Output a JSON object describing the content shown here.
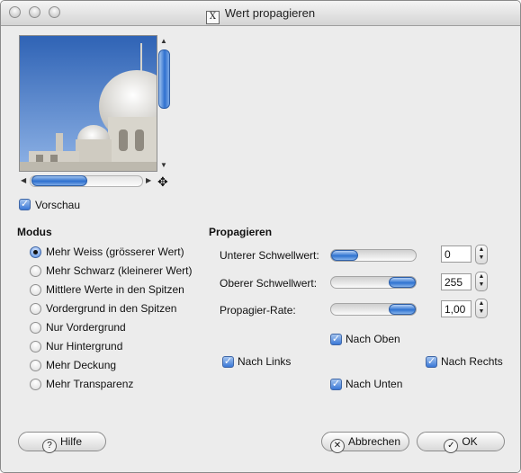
{
  "window": {
    "title": "Wert propagieren",
    "x11_glyph": "X"
  },
  "preview": {
    "checkbox_label": "Vorschau",
    "checked": true
  },
  "modus": {
    "heading": "Modus",
    "options": [
      {
        "label": "Mehr Weiss (grösserer Wert)",
        "selected": true
      },
      {
        "label": "Mehr Schwarz (kleinerer Wert)",
        "selected": false
      },
      {
        "label": "Mittlere Werte in den Spitzen",
        "selected": false
      },
      {
        "label": "Vordergrund in den Spitzen",
        "selected": false
      },
      {
        "label": "Nur Vordergrund",
        "selected": false
      },
      {
        "label": "Nur Hintergrund",
        "selected": false
      },
      {
        "label": "Mehr Deckung",
        "selected": false
      },
      {
        "label": "Mehr Transparenz",
        "selected": false
      }
    ]
  },
  "propagieren": {
    "heading": "Propagieren",
    "sliders": [
      {
        "label": "Unterer Schwellwert:",
        "value": "0",
        "fraction": 0.0
      },
      {
        "label": "Oberer Schwellwert:",
        "value": "255",
        "fraction": 1.0
      },
      {
        "label": "Propagier-Rate:",
        "value": "1,00",
        "fraction": 1.0
      }
    ],
    "directions": {
      "up": "Nach Oben",
      "left": "Nach Links",
      "right": "Nach Rechts",
      "down": "Nach Unten"
    }
  },
  "buttons": {
    "help": "Hilfe",
    "cancel": "Abbrechen",
    "ok": "OK"
  },
  "glyphs": {
    "help_icon": "?",
    "cancel_icon": "✕",
    "ok_icon": "✓",
    "check": "✓"
  }
}
